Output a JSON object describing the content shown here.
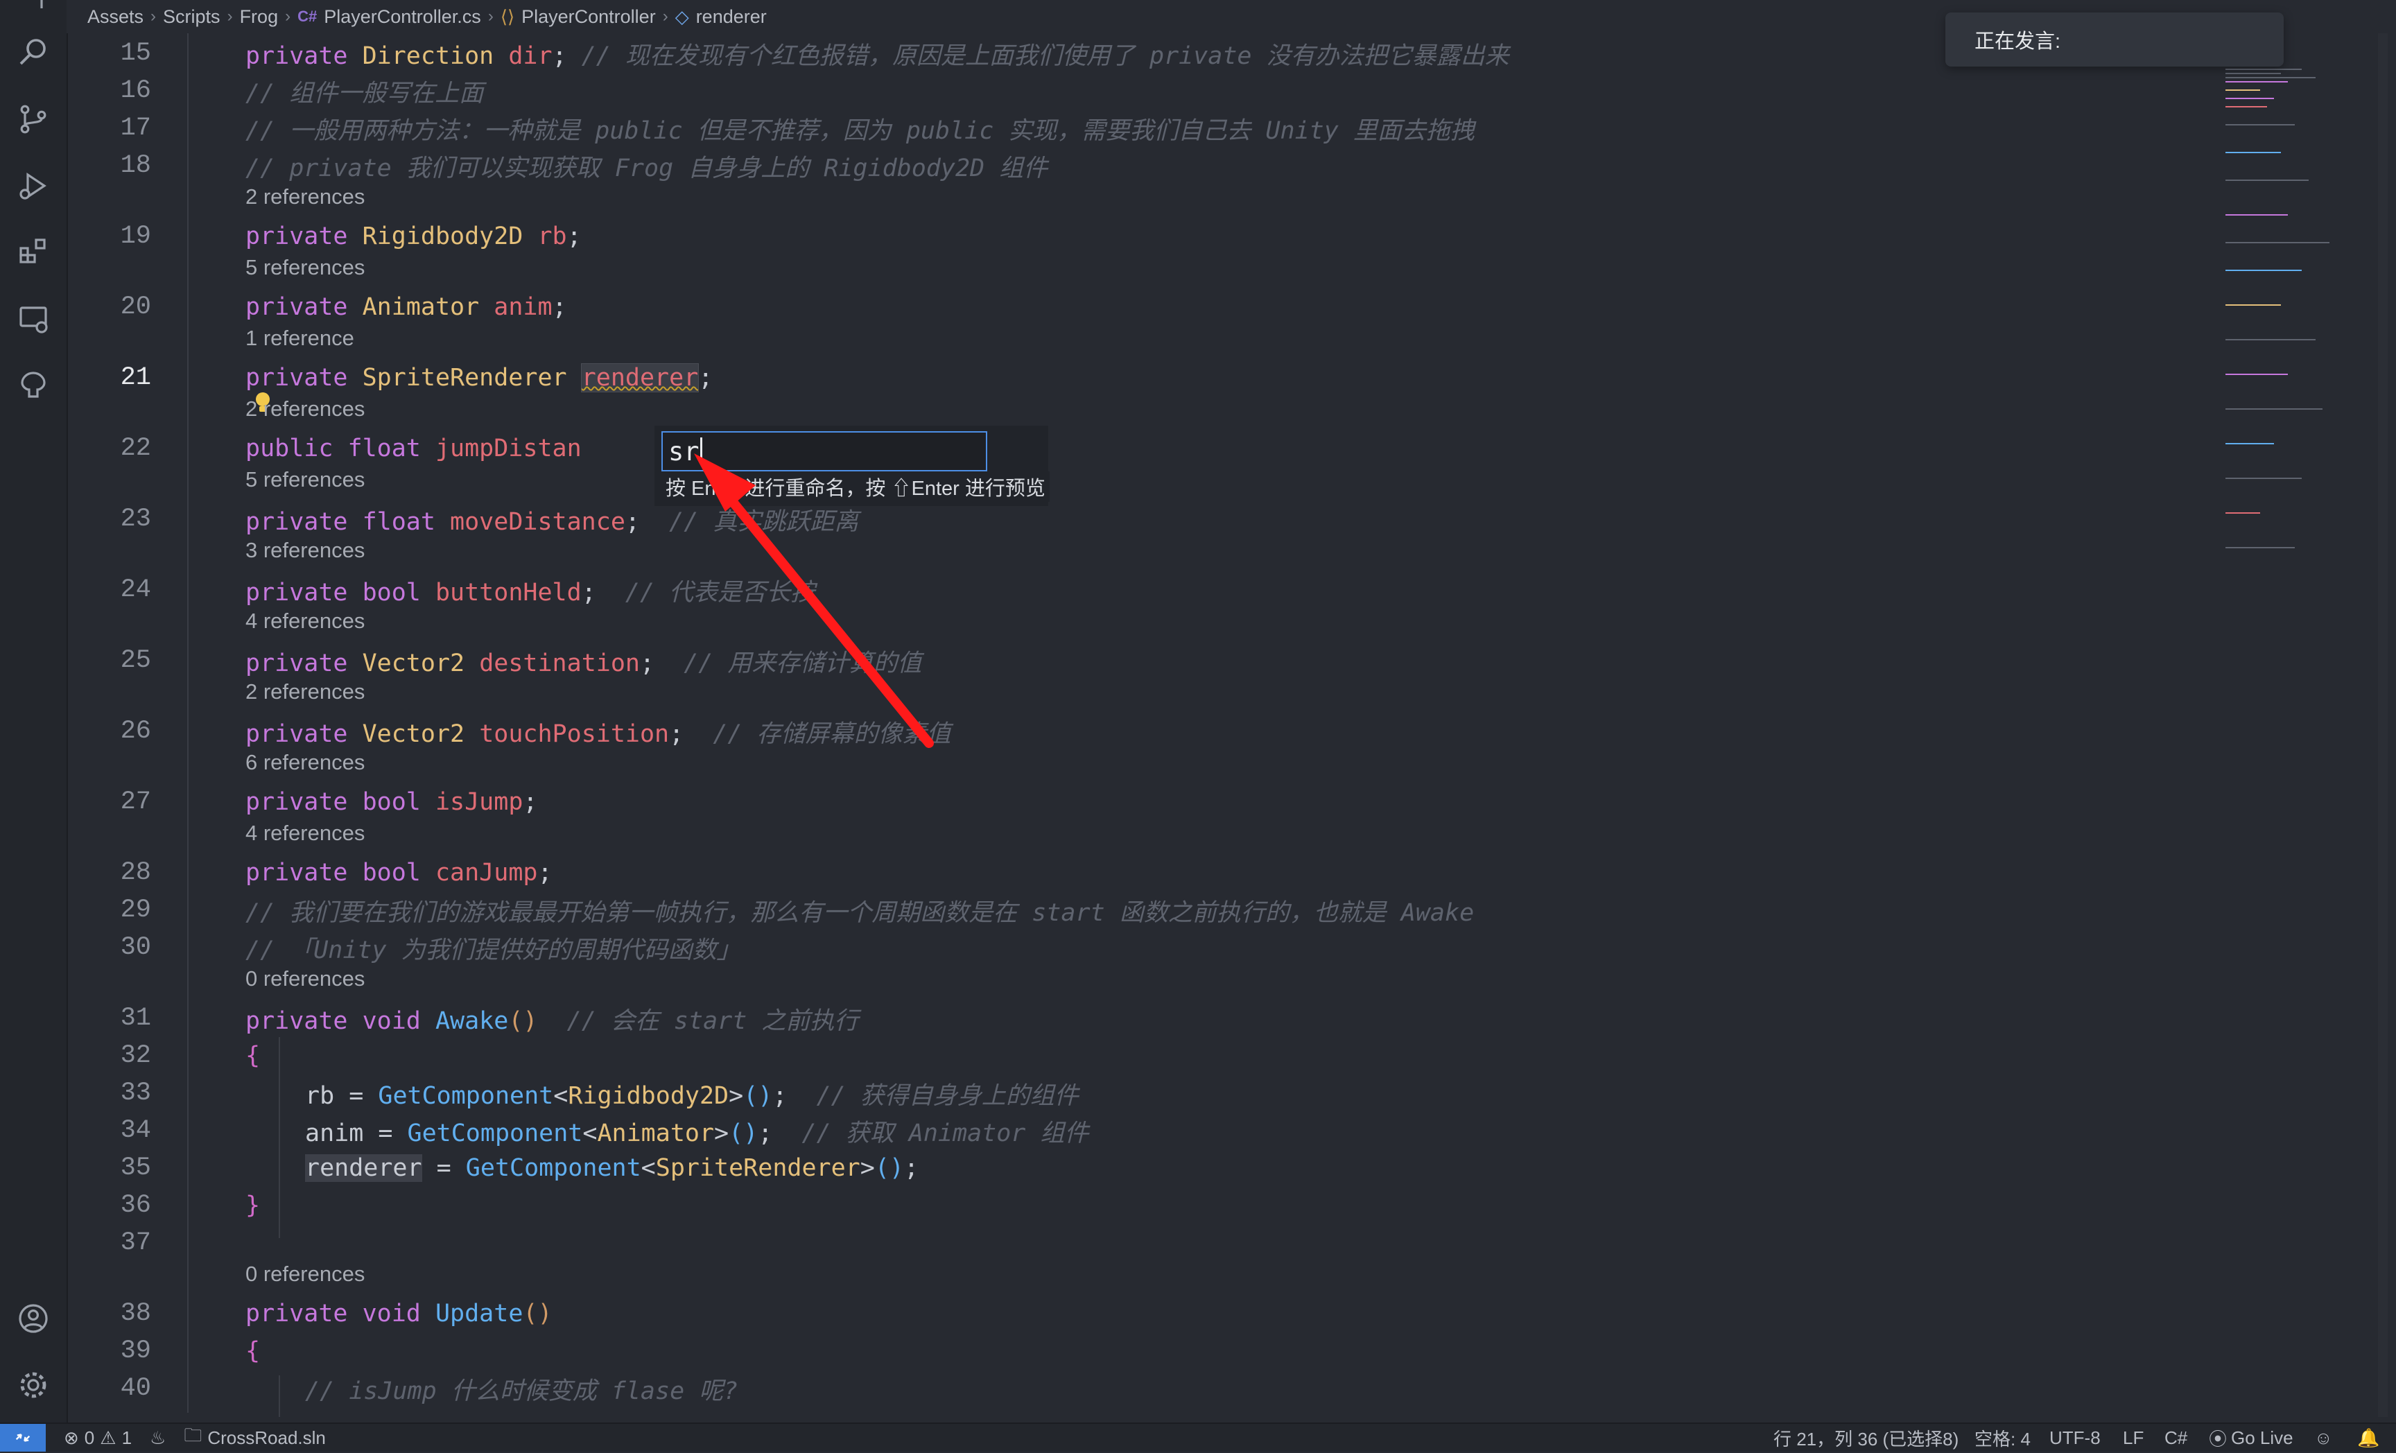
{
  "breadcrumb": {
    "items": [
      "Assets",
      "Scripts",
      "Frog",
      "PlayerController.cs",
      "PlayerController",
      "renderer"
    ],
    "file_lang_badge": "C#"
  },
  "notification": {
    "text": "正在发言:"
  },
  "code_lines": [
    {
      "n": "15",
      "text": "private Direction dir; // 现在发现有个红色报错，原因是上面我们使用了 private 没有办法把它暴露出来"
    },
    {
      "n": "16",
      "text": "// 组件一般写在上面"
    },
    {
      "n": "17",
      "text": "// 一般用两种方法：一种就是 public 但是不推荐，因为 public 实现，需要我们自己去 Unity 里面去拖拽"
    },
    {
      "n": "18",
      "text": "// private 我们可以实现获取 Frog 自身身上的 Rigidbody2D 组件"
    },
    {
      "n": "19",
      "text": "private Rigidbody2D rb;"
    },
    {
      "n": "20",
      "text": "private Animator anim;"
    },
    {
      "n": "21",
      "text": "private SpriteRenderer renderer;"
    },
    {
      "n": "22",
      "text": "public float jumpDistan"
    },
    {
      "n": "23",
      "text": "private float moveDistance;  // 真实跳跃距离"
    },
    {
      "n": "24",
      "text": "private bool buttonHeld;  // 代表是否长按"
    },
    {
      "n": "25",
      "text": "private Vector2 destination;  // 用来存储计算的值"
    },
    {
      "n": "26",
      "text": "private Vector2 touchPosition;  // 存储屏幕的像素值"
    },
    {
      "n": "27",
      "text": "private bool isJump;"
    },
    {
      "n": "28",
      "text": "private bool canJump;"
    },
    {
      "n": "29",
      "text": "// 我们要在我们的游戏最最开始第一帧执行，那么有一个周期函数是在 start 函数之前执行的，也就是 Awake"
    },
    {
      "n": "30",
      "text": "// 「Unity 为我们提供好的周期代码函数」"
    },
    {
      "n": "31",
      "text": "private void Awake()  // 会在 start 之前执行"
    },
    {
      "n": "32",
      "text": "{"
    },
    {
      "n": "33",
      "text": "rb = GetComponent<Rigidbody2D>();  // 获得自身身上的组件"
    },
    {
      "n": "34",
      "text": "anim = GetComponent<Animator>();  // 获取 Animator 组件"
    },
    {
      "n": "35",
      "text": "renderer = GetComponent<SpriteRenderer>();"
    },
    {
      "n": "36",
      "text": "}"
    },
    {
      "n": "37",
      "text": ""
    },
    {
      "n": "38",
      "text": "private void Update()"
    },
    {
      "n": "39",
      "text": "{"
    },
    {
      "n": "40",
      "text": "// isJump 什么时候变成 flase 呢?"
    }
  ],
  "codelens": {
    "before_19": "2 references",
    "before_20": "5 references",
    "before_21": "1 reference",
    "before_22": "2 references",
    "before_23": "5 references",
    "before_24": "3 references",
    "before_25": "4 references",
    "before_26": "2 references",
    "before_27": "6 references",
    "before_28": "4 references",
    "before_31": "0 references",
    "before_38": "0 references"
  },
  "rename_widget": {
    "value": "sr",
    "hint": "按 Enter 进行重命名，按 ⇧Enter 进行预览"
  },
  "status_bar": {
    "errors": "0",
    "warnings": "1",
    "solution": "CrossRoad.sln",
    "position": "行 21，列 36 (已选择8)",
    "spaces": "空格: 4",
    "encoding": "UTF-8",
    "eol": "LF",
    "language": "C#",
    "go_live": "Go Live"
  },
  "colors": {
    "accent": "#3a7bd5",
    "keyword": "#c678dd",
    "type": "#e5c07b",
    "identifier": "#e06c75",
    "function": "#61afef",
    "comment": "#5e636e",
    "annotation_arrow": "#ff1a1a"
  },
  "icons": [
    "explorer-icon",
    "search-icon",
    "source-control-icon",
    "run-debug-icon",
    "extensions-icon",
    "remote-explorer-icon",
    "testing-icon",
    "accounts-icon",
    "settings-gear-icon",
    "lightbulb-icon"
  ]
}
